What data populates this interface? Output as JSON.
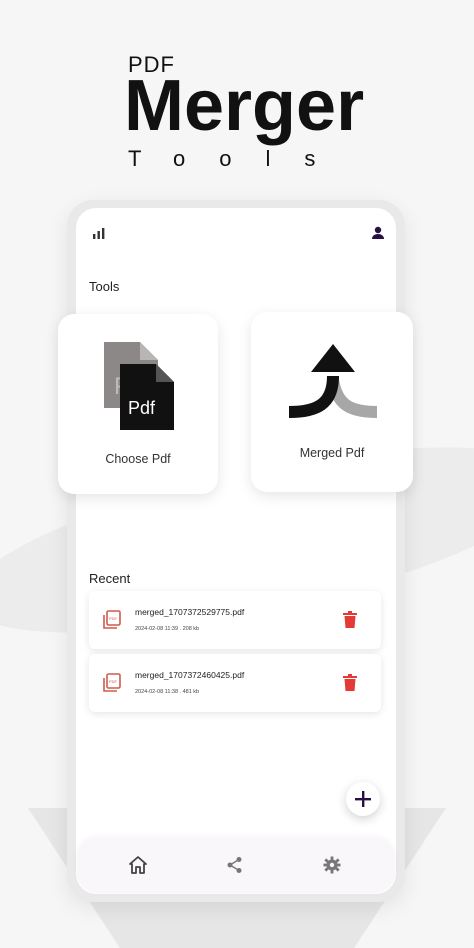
{
  "promo": {
    "pdf_label": "PDF",
    "title": "Merger",
    "subtitle": "Tools"
  },
  "status": {
    "signal_icon": "signal-bars-icon",
    "profile_icon": "person-icon"
  },
  "tools_section": {
    "title": "Tools",
    "cards": [
      {
        "label": "Choose Pdf",
        "icon": "pdf-file-icon",
        "art_text": "Pdf"
      },
      {
        "label": "Merged Pdf",
        "icon": "merge-arrow-icon"
      }
    ]
  },
  "recent_section": {
    "title": "Recent",
    "items": [
      {
        "name": "merged_1707372529775.pdf",
        "meta": "2024-02-08 11:39 . 208 kb"
      },
      {
        "name": "merged_1707372460425.pdf",
        "meta": "2024-02-08 11:38 . 481 kb"
      }
    ]
  },
  "fab": {
    "icon": "plus-icon"
  },
  "bottom_nav": [
    {
      "name": "home",
      "icon": "home-icon"
    },
    {
      "name": "share",
      "icon": "share-icon"
    },
    {
      "name": "settings",
      "icon": "gear-icon"
    }
  ],
  "colors": {
    "accent": "#2a0f47",
    "danger": "#e53935",
    "file_icon": "#d05a4b",
    "nav_icon": "#555555"
  }
}
